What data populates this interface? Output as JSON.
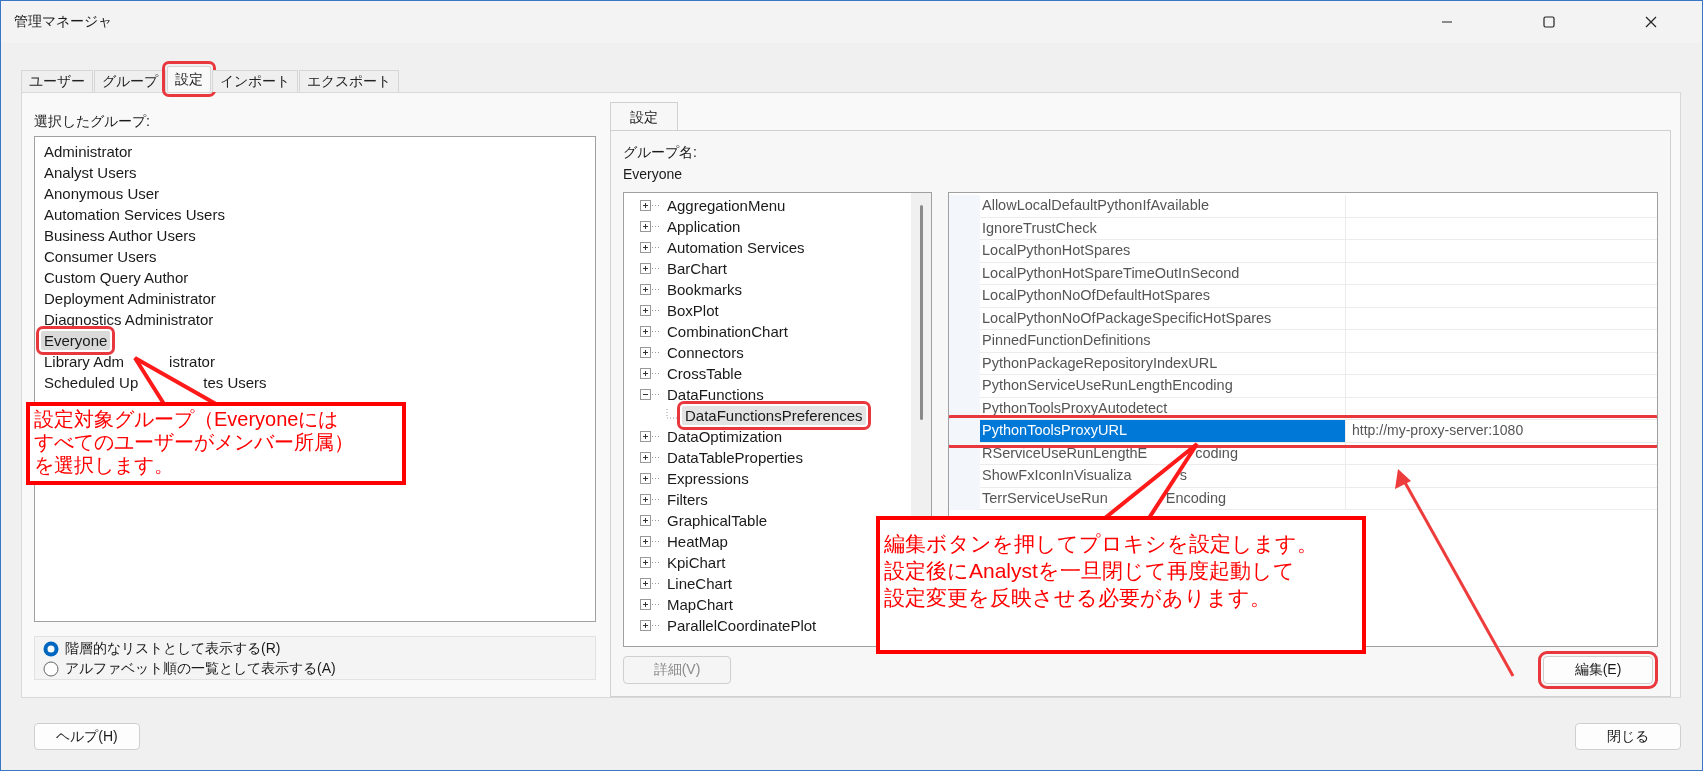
{
  "window": {
    "title": "管理マネージャ"
  },
  "tabs": [
    {
      "label": "ユーザー",
      "selected": false
    },
    {
      "label": "グループ",
      "selected": false
    },
    {
      "label": "設定",
      "selected": true,
      "outlined": true
    },
    {
      "label": "インポート",
      "selected": false
    },
    {
      "label": "エクスポート",
      "selected": false
    }
  ],
  "group_panel": {
    "label": "選択したグループ:",
    "groups": [
      {
        "label": "Administrator",
        "selected": false
      },
      {
        "label": "Analyst Users",
        "selected": false
      },
      {
        "label": "Anonymous User",
        "selected": false
      },
      {
        "label": "Automation Services Users",
        "selected": false
      },
      {
        "label": "Business Author Users",
        "selected": false
      },
      {
        "label": "Consumer Users",
        "selected": false
      },
      {
        "label": "Custom Query Author",
        "selected": false
      },
      {
        "label": "Deployment Administrator",
        "selected": false
      },
      {
        "label": "Diagnostics Administrator",
        "selected": false
      },
      {
        "label": "Everyone",
        "selected": true,
        "outlined": true
      },
      {
        "label": "Library Adm",
        "label_rest": "istrator",
        "selected": false
      },
      {
        "label": "Scheduled Up",
        "label_rest": "tes Users",
        "selected": false
      }
    ],
    "view_options": [
      {
        "label": "階層的なリストとして表示する(R)",
        "selected": true
      },
      {
        "label": "アルファベット順の一覧として表示する(A)",
        "selected": false
      }
    ]
  },
  "settings_panel": {
    "tab": {
      "label": "設定",
      "selected": true
    },
    "group_name_label": "グループ名:",
    "group_name": "Everyone",
    "tree": [
      {
        "label": "AggregationMenu",
        "expanded": false,
        "selected": false
      },
      {
        "label": "Application",
        "expanded": false,
        "selected": false
      },
      {
        "label": "Automation Services",
        "expanded": false,
        "selected": false
      },
      {
        "label": "BarChart",
        "expanded": false,
        "selected": false
      },
      {
        "label": "Bookmarks",
        "expanded": false,
        "selected": false
      },
      {
        "label": "BoxPlot",
        "expanded": false,
        "selected": false
      },
      {
        "label": "CombinationChart",
        "expanded": false,
        "selected": false
      },
      {
        "label": "Connectors",
        "expanded": false,
        "selected": false
      },
      {
        "label": "CrossTable",
        "expanded": false,
        "selected": false
      },
      {
        "label": "DataFunctions",
        "expanded": true,
        "selected": false,
        "children": [
          {
            "label": "DataFunctionsPreferences",
            "selected": true,
            "outlined": true
          }
        ]
      },
      {
        "label": "DataOptimization",
        "expanded": false,
        "selected": false
      },
      {
        "label": "DataTableProperties",
        "expanded": false,
        "selected": false
      },
      {
        "label": "Expressions",
        "expanded": false,
        "selected": false
      },
      {
        "label": "Filters",
        "expanded": false,
        "selected": false
      },
      {
        "label": "GraphicalTable",
        "expanded": false,
        "selected": false
      },
      {
        "label": "HeatMap",
        "expanded": false,
        "selected": false
      },
      {
        "label": "KpiChart",
        "expanded": false,
        "selected": false
      },
      {
        "label": "LineChart",
        "expanded": false,
        "selected": false
      },
      {
        "label": "MapChart",
        "expanded": false,
        "selected": false
      },
      {
        "label": "ParallelCoordinatePlot",
        "expanded": false,
        "selected": false
      }
    ],
    "properties": [
      {
        "name": "AllowLocalDefaultPythonIfAvailable",
        "selected": false
      },
      {
        "name": "IgnoreTrustCheck",
        "selected": false
      },
      {
        "name": "LocalPythonHotSpares",
        "selected": false
      },
      {
        "name": "LocalPythonHotSpareTimeOutInSecond",
        "selected": false
      },
      {
        "name": "LocalPythonNoOfDefaultHotSpares",
        "selected": false
      },
      {
        "name": "LocalPythonNoOfPackageSpecificHotSpares",
        "selected": false
      },
      {
        "name": "PinnedFunctionDefinitions",
        "selected": false
      },
      {
        "name": "PythonPackageRepositoryIndexURL",
        "selected": false
      },
      {
        "name": "PythonServiceUseRunLengthEncoding",
        "selected": false
      },
      {
        "name": "PythonToolsProxyAutodetect",
        "selected": false
      },
      {
        "name": "PythonToolsProxyURL",
        "value": "http://my-proxy-server:1080",
        "selected": true,
        "outlined": true
      },
      {
        "name": "RServiceUseRunLengthE",
        "name_rest": "coding",
        "selected": false
      },
      {
        "name": "ShowFxIconInVisualiza",
        "name_rest": "s",
        "selected": false
      },
      {
        "name": "TerrServiceUseRun",
        "name_rest": "Encoding",
        "selected": false
      }
    ],
    "details_button": {
      "label": "詳細(V)",
      "disabled": true
    },
    "edit_button": {
      "label": "編集(E)",
      "outlined": true
    }
  },
  "help_button": {
    "label": "ヘルプ(H)"
  },
  "close_button": {
    "label": "閉じる"
  },
  "callouts": [
    {
      "lines": [
        "設定対象グループ（Everyoneには",
        "すべてのユーザーがメンバー所属）",
        "を選択します。"
      ]
    },
    {
      "lines": [
        "編集ボタンを押してプロキシを設定します。",
        "設定後にAnalystを一旦閉じて再度起動して",
        "設定変更を反映させる必要があります。"
      ]
    }
  ]
}
